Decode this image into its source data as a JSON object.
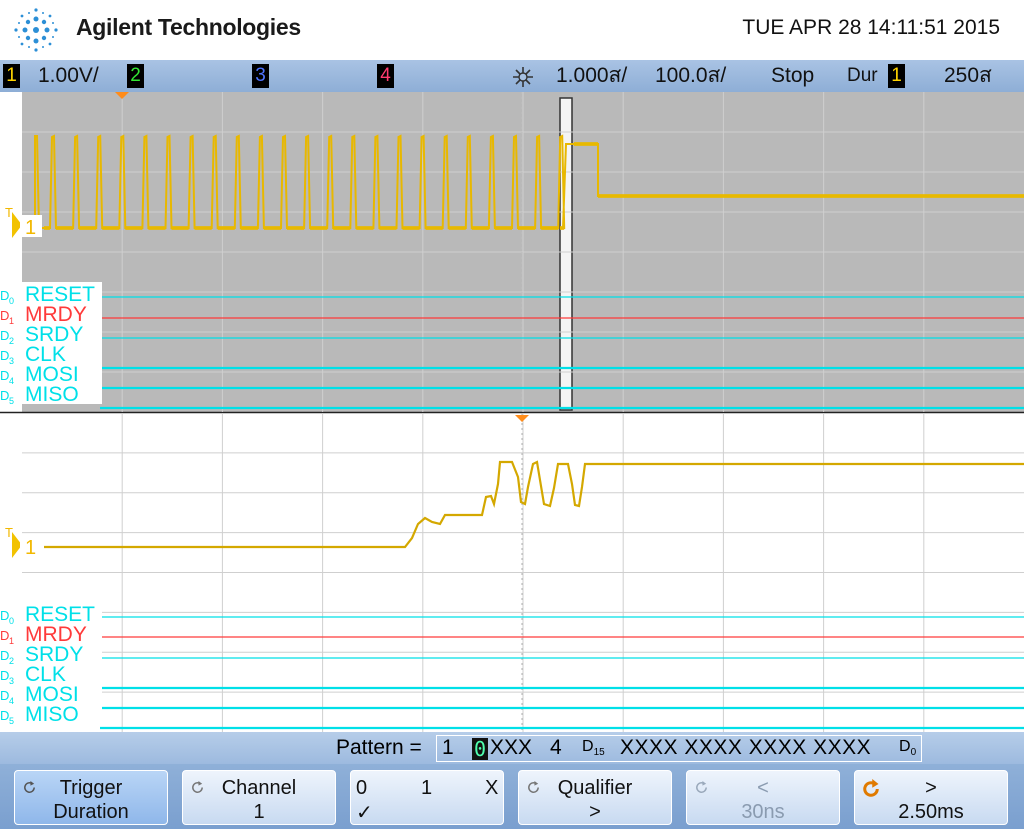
{
  "header": {
    "brand": "Agilent Technologies",
    "datetime": "TUE APR 28 14:11:51 2015"
  },
  "statusbar": {
    "ch1": {
      "num": "1",
      "scale": "1.00V/",
      "color": "#ffd400"
    },
    "ch2": {
      "num": "2",
      "color": "#33e633"
    },
    "ch3": {
      "num": "3",
      "color": "#4f74ff"
    },
    "ch4": {
      "num": "4",
      "color": "#ff3b6f"
    },
    "timebase": "1.000ส/",
    "delay": "100.0ส/",
    "run_state": "Stop",
    "trigger_mode": "Dur",
    "trigger_source": "1",
    "trigger_level": "250ส"
  },
  "upper": {
    "ch1_marker": "1",
    "trig_marker": "T",
    "digital": [
      {
        "id": "D0",
        "prefix": "D",
        "sub": "0",
        "name": "RESET",
        "color": "#00e0e8"
      },
      {
        "id": "D1",
        "prefix": "D",
        "sub": "1",
        "name": "MRDY",
        "color": "#ff3a3a"
      },
      {
        "id": "D2",
        "prefix": "D",
        "sub": "2",
        "name": "SRDY",
        "color": "#00e0e8"
      },
      {
        "id": "D3",
        "prefix": "D",
        "sub": "3",
        "name": "CLK",
        "color": "#00e0e8"
      },
      {
        "id": "D4",
        "prefix": "D",
        "sub": "4",
        "name": "MOSI",
        "color": "#00e0e8"
      },
      {
        "id": "D5",
        "prefix": "D",
        "sub": "5",
        "name": "MISO",
        "color": "#00e0e8"
      }
    ]
  },
  "lower": {
    "ch1_marker": "1",
    "trig_marker": "T"
  },
  "pattern": {
    "label": "Pattern =",
    "ch1": "1",
    "selected": "0",
    "after_selected": "XXX",
    "ch4": "4",
    "d15_prefix": "D",
    "d15_sub": "15",
    "groups": "XXXX XXXX XXXX XXXX",
    "d0_prefix": "D",
    "d0_sub": "0"
  },
  "softkeys": {
    "trigger": {
      "line1": "Trigger",
      "line2": "Duration"
    },
    "channel": {
      "line1": "Channel",
      "line2": "1"
    },
    "level": {
      "zero": "0",
      "one": "1",
      "x": "X",
      "check": "✓"
    },
    "qualifier": {
      "line1": "Qualifier",
      "line2": ">"
    },
    "less": {
      "line1": "<",
      "line2": "30ns"
    },
    "greater": {
      "line1": ">",
      "line2": "2.50ms"
    }
  },
  "colors": {
    "ch1": "#e8b800",
    "digital": "#00e0e8",
    "mrdy": "#ff3a3a",
    "grid": "#c8c8c8",
    "upper_bg": "#b9b9b9",
    "accent": "#7ea3d4"
  }
}
